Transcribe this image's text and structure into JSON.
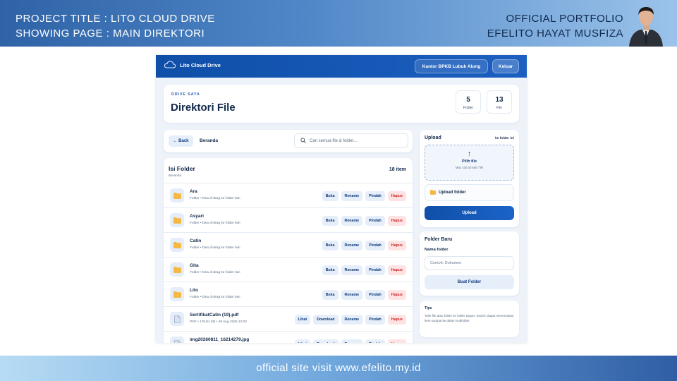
{
  "frame": {
    "project_title": "PROJECT TITLE  : LITO CLOUD DRIVE",
    "showing_page": "SHOWING PAGE : MAIN DIREKTORI",
    "portfolio_label": "OFFICIAL PORTFOLIO",
    "author_name": "EFELITO HAYAT MUSFIZA",
    "footer": "official site visit www.efelito.my.id"
  },
  "app": {
    "brand": "Lito Cloud Drive",
    "office_chip": "Kantor BPKB Lubuk Alung",
    "logout_label": "Keluar",
    "header": {
      "eyebrow": "DRIVE SAYA",
      "title": "Direktori File",
      "stats": [
        {
          "value": "5",
          "label": "Folder"
        },
        {
          "value": "13",
          "label": "File"
        }
      ]
    },
    "nav": {
      "back_label": "← Back",
      "breadcrumb": "Beranda",
      "search_placeholder": "Cari semua file & folder..."
    },
    "list": {
      "title": "Isi Folder",
      "subtitle": "Beranda",
      "count": "18 item",
      "rows": [
        {
          "name": "Ara",
          "meta": "Folder • bisa di-drag ke folder lain",
          "type": "folder",
          "actions": [
            "Buka",
            "Rename",
            "Pindah",
            "Hapus"
          ]
        },
        {
          "name": "Asyari",
          "meta": "Folder • bisa di-drag ke folder lain",
          "type": "folder",
          "actions": [
            "Buka",
            "Rename",
            "Pindah",
            "Hapus"
          ]
        },
        {
          "name": "Catin",
          "meta": "Folder • bisa di-drag ke folder lain",
          "type": "folder",
          "actions": [
            "Buka",
            "Rename",
            "Pindah",
            "Hapus"
          ]
        },
        {
          "name": "Gita",
          "meta": "Folder • bisa di-drag ke folder lain",
          "type": "folder",
          "actions": [
            "Buka",
            "Rename",
            "Pindah",
            "Hapus"
          ]
        },
        {
          "name": "Lito",
          "meta": "Folder • bisa di-drag ke folder lain",
          "type": "folder",
          "actions": [
            "Buka",
            "Rename",
            "Pindah",
            "Hapus"
          ]
        },
        {
          "name": "SertifikatCatin (19).pdf",
          "meta": "PDF • 175.81 KB • 26 Aug 2026 12:03",
          "type": "file",
          "actions": [
            "Lihat",
            "Download",
            "Rename",
            "Pindah",
            "Hapus"
          ]
        },
        {
          "name": "img20260811_16214279.jpg",
          "meta": "",
          "type": "file",
          "actions": [
            "Lihat",
            "Download",
            "Rename",
            "Pindah",
            "Hapus"
          ]
        }
      ]
    },
    "upload": {
      "title": "Upload",
      "destination": "ke folder ini",
      "pick_label": "Pilih file",
      "max_note": "Max 100.00 MB / file",
      "folder_upload_label": "Upload folder",
      "button_label": "Upload"
    },
    "new_folder": {
      "title": "Folder Baru",
      "field_label": "Nama folder",
      "placeholder": "Contoh: Dokumen",
      "button_label": "Buat Folder"
    },
    "tips": {
      "title": "Tips",
      "body": "Tarik file atau folder ke folder tujuan. Search dapat menemukan item sampai ke dalam subfolder."
    }
  }
}
